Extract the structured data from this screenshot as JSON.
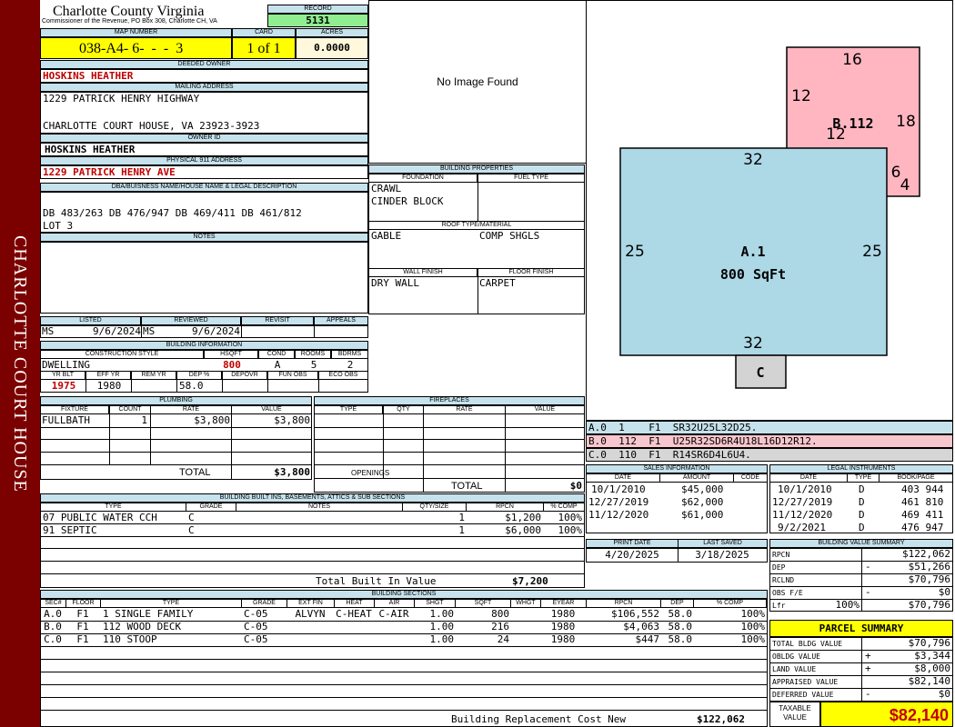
{
  "sidebar": "CHARLOTTE COURT HOUSE",
  "county": "Charlotte County Virginia",
  "commissioner": "Commissioner of the Revenue, PO Box 308, Charlotte CH, VA",
  "record": {
    "label": "RECORD",
    "value": "5131"
  },
  "map": {
    "label": "MAP NUMBER",
    "value": "038-A4- 6-  -  -  3"
  },
  "card": {
    "label": "CARD",
    "value": "1 of 1"
  },
  "acres": {
    "label": "ACRES",
    "value": "0.0000"
  },
  "deeded_owner": {
    "label": "DEEDED OWNER",
    "value": "HOSKINS HEATHER"
  },
  "mailing": {
    "label": "MAILING ADDRESS",
    "line1": "1229 PATRICK HENRY HIGHWAY",
    "line2": "CHARLOTTE COURT HOUSE, VA 23923-3923"
  },
  "owner_id": {
    "label": "OWNER ID",
    "value": "HOSKINS HEATHER"
  },
  "physical": {
    "label": "PHYSICAL 911 ADDRESS",
    "value": "1229 PATRICK HENRY AVE"
  },
  "dba": {
    "label": "DBA/BUISNESS NAME/HOUSE NAME & LEGAL DESCRIPTION",
    "line1": "DB 483/263 DB 476/947 DB 469/411 DB 461/812",
    "line2": "LOT 3"
  },
  "notes": {
    "label": "NOTES"
  },
  "listed": {
    "label": "LISTED",
    "by": "MS",
    "date": "9/6/2024"
  },
  "reviewed": {
    "label": "REVIEWED",
    "by": "MS",
    "date": "9/6/2024"
  },
  "revisit": {
    "label": "REVISIT"
  },
  "appeals": {
    "label": "APPEALS"
  },
  "bldg_info": {
    "label": "BUILDING INFORMATION",
    "h_cs": "CONSTRUCTION STYLE",
    "h_hsqft": "HSQFT",
    "h_cond": "COND",
    "h_rooms": "ROOMS",
    "h_bdrms": "BDRMS",
    "cs": "DWELLING",
    "hsqft": "800",
    "cond": "A",
    "rooms": "5",
    "bdrms": "2",
    "h_yrblt": "YR BLT",
    "h_effyr": "EFF YR",
    "h_remyr": "REM YR",
    "h_dep": "DEP %",
    "h_depovr": "DEPOVR",
    "h_funobs": "FUN OBS",
    "h_ecoobs": "ECO OBS",
    "yrblt": "1975",
    "effyr": "1980",
    "dep": "58.0"
  },
  "no_image": "No Image Found",
  "bprops": {
    "label": "BUILDING PROPERTIES",
    "h_found": "FOUNDATION",
    "h_fuel": "FUEL TYPE",
    "found1": "CRAWL",
    "found2": "CINDER BLOCK",
    "h_roof": "ROOF TYPE/MATERIAL",
    "roof1": "GABLE",
    "roof2": "COMP SHGLS",
    "h_wall": "WALL FINISH",
    "h_floor": "FLOOR FINISH",
    "wall": "DRY WALL",
    "floor": "CARPET"
  },
  "plumbing": {
    "label": "PLUMBING",
    "h": [
      "FIXTURE",
      "COUNT",
      "RATE",
      "VALUE"
    ],
    "rows": [
      [
        "FULLBATH",
        "1",
        "$3,800",
        "$3,800"
      ]
    ],
    "total_label": "TOTAL",
    "total": "$3,800"
  },
  "fireplaces": {
    "label": "FIREPLACES",
    "h": [
      "TYPE",
      "QTY",
      "RATE",
      "VALUE"
    ],
    "openings": "OPENINGS",
    "total_label": "TOTAL",
    "total": "$0"
  },
  "builtins": {
    "label": "BUILDING BUILT INS, BASEMENTS, ATTICS & SUB SECTIONS",
    "h": [
      "TYPE",
      "GRADE",
      "NOTES",
      "QTY/SIZE",
      "RPCN",
      "% COMP"
    ],
    "rows": [
      [
        "07 PUBLIC WATER CCH",
        "C",
        "",
        "1",
        "$1,200",
        "100%"
      ],
      [
        "91 SEPTIC",
        "C",
        "",
        "1",
        "$6,000",
        "100%"
      ]
    ],
    "total_label": "Total Built In Value",
    "total": "$7,200"
  },
  "sketch": {
    "lines": [
      {
        "text": "A.0  1    F1  SR32U25L32D25.",
        "color": "#c6e2ec"
      },
      {
        "text": "B.0  112  F1  U25R32SD6R4U18L16D12R12.",
        "color": "#f8c6cd"
      },
      {
        "text": "C.0  110  F1  R14SR6D4L6U4.",
        "color": "#d6d6d6"
      }
    ],
    "a_label": "A.1",
    "a_area": "800 SqFt",
    "b_label": "B.112",
    "c_label": "C",
    "dims": {
      "a_top": "32",
      "a_bottom": "32",
      "a_left": "25",
      "a_right": "25",
      "b_top": "16",
      "b_left": "12",
      "b_inner": "12",
      "b_right": "18",
      "b_6": "6",
      "b_4": "4"
    },
    "colors": {
      "a": "#add8e6",
      "b": "#ffb6c1",
      "c": "#d3d3d3"
    }
  },
  "sales": {
    "label": "SALES INFORMATION",
    "h": [
      "DATE",
      "AMOUNT",
      "CODE"
    ],
    "rows": [
      [
        "10/1/2010",
        "$45,000",
        ""
      ],
      [
        "12/27/2019",
        "$62,000",
        ""
      ],
      [
        "11/12/2020",
        "$61,000",
        ""
      ]
    ]
  },
  "legal": {
    "label": "LEGAL INSTRUMENTS",
    "h": [
      "DATE",
      "TYPE",
      "BOOK/PAGE"
    ],
    "rows": [
      [
        "10/1/2010",
        "D",
        "403 944"
      ],
      [
        "12/27/2019",
        "D",
        "461 810"
      ],
      [
        "11/12/2020",
        "D",
        "469 411"
      ],
      [
        "9/2/2021",
        "D",
        "476 947"
      ]
    ]
  },
  "print_date": {
    "label": "PRINT DATE",
    "value": "4/20/2025"
  },
  "last_saved": {
    "label": "LAST SAVED",
    "value": "3/18/2025"
  },
  "bvs": {
    "label": "BUILDING VALUE SUMMARY",
    "rows": [
      {
        "l": "RPCN",
        "s": "",
        "v": "$122,062"
      },
      {
        "l": "DEP",
        "s": "-",
        "v": "$51,266"
      },
      {
        "l": "RCLND",
        "s": "",
        "v": "$70,796"
      },
      {
        "l": "OBS F/E",
        "s": "-",
        "v": "$0"
      },
      {
        "l": "Lfr",
        "p": "100%",
        "s": "",
        "v": "$70,796"
      }
    ]
  },
  "sections": {
    "label": "BUILDING SECTIONS",
    "h": [
      "SEC#",
      "FLOOR",
      "TYPE",
      "GRADE",
      "EXT FIN",
      "HEAT",
      "AIR",
      "SHGT",
      "SQFT",
      "WHGT",
      "EYEAR",
      "RPCN",
      "DEP",
      "% COMP"
    ],
    "rows": [
      [
        "A.0",
        "F1",
        "1 SINGLE FAMILY",
        "C-05",
        "ALVYN",
        "C-HEAT",
        "C-AIR",
        "1.00",
        "800",
        "",
        "1980",
        "$106,552",
        "58.0",
        "100%"
      ],
      [
        "B.0",
        "F1",
        "112 WOOD DECK",
        "C-05",
        "",
        "",
        "",
        "1.00",
        "216",
        "",
        "1980",
        "$4,063",
        "58.0",
        "100%"
      ],
      [
        "C.0",
        "F1",
        "110 STOOP",
        "C-05",
        "",
        "",
        "",
        "1.00",
        "24",
        "",
        "1980",
        "$447",
        "58.0",
        "100%"
      ]
    ],
    "total_label": "Building Replacement Cost New",
    "total": "$122,062"
  },
  "parcel": {
    "label": "PARCEL SUMMARY",
    "rows": [
      {
        "l": "TOTAL BLDG VALUE",
        "s": "",
        "v": "$70,796"
      },
      {
        "l": "OBLDG VALUE",
        "s": "+",
        "v": "$3,344"
      },
      {
        "l": "LAND VALUE",
        "s": "+",
        "v": "$8,000"
      },
      {
        "l": "APPRAISED VALUE",
        "s": "",
        "v": "$82,140"
      },
      {
        "l": "DEFERRED VALUE",
        "s": "-",
        "v": "$0"
      }
    ],
    "taxable_label1": "TAXABLE",
    "taxable_label2": "VALUE",
    "taxable": "$82,140"
  },
  "colors": {
    "sidebar": "#7b0000",
    "header": "#c6e2ec",
    "yellow": "#ffff00",
    "green": "#90ee90",
    "red": "#c00000"
  }
}
